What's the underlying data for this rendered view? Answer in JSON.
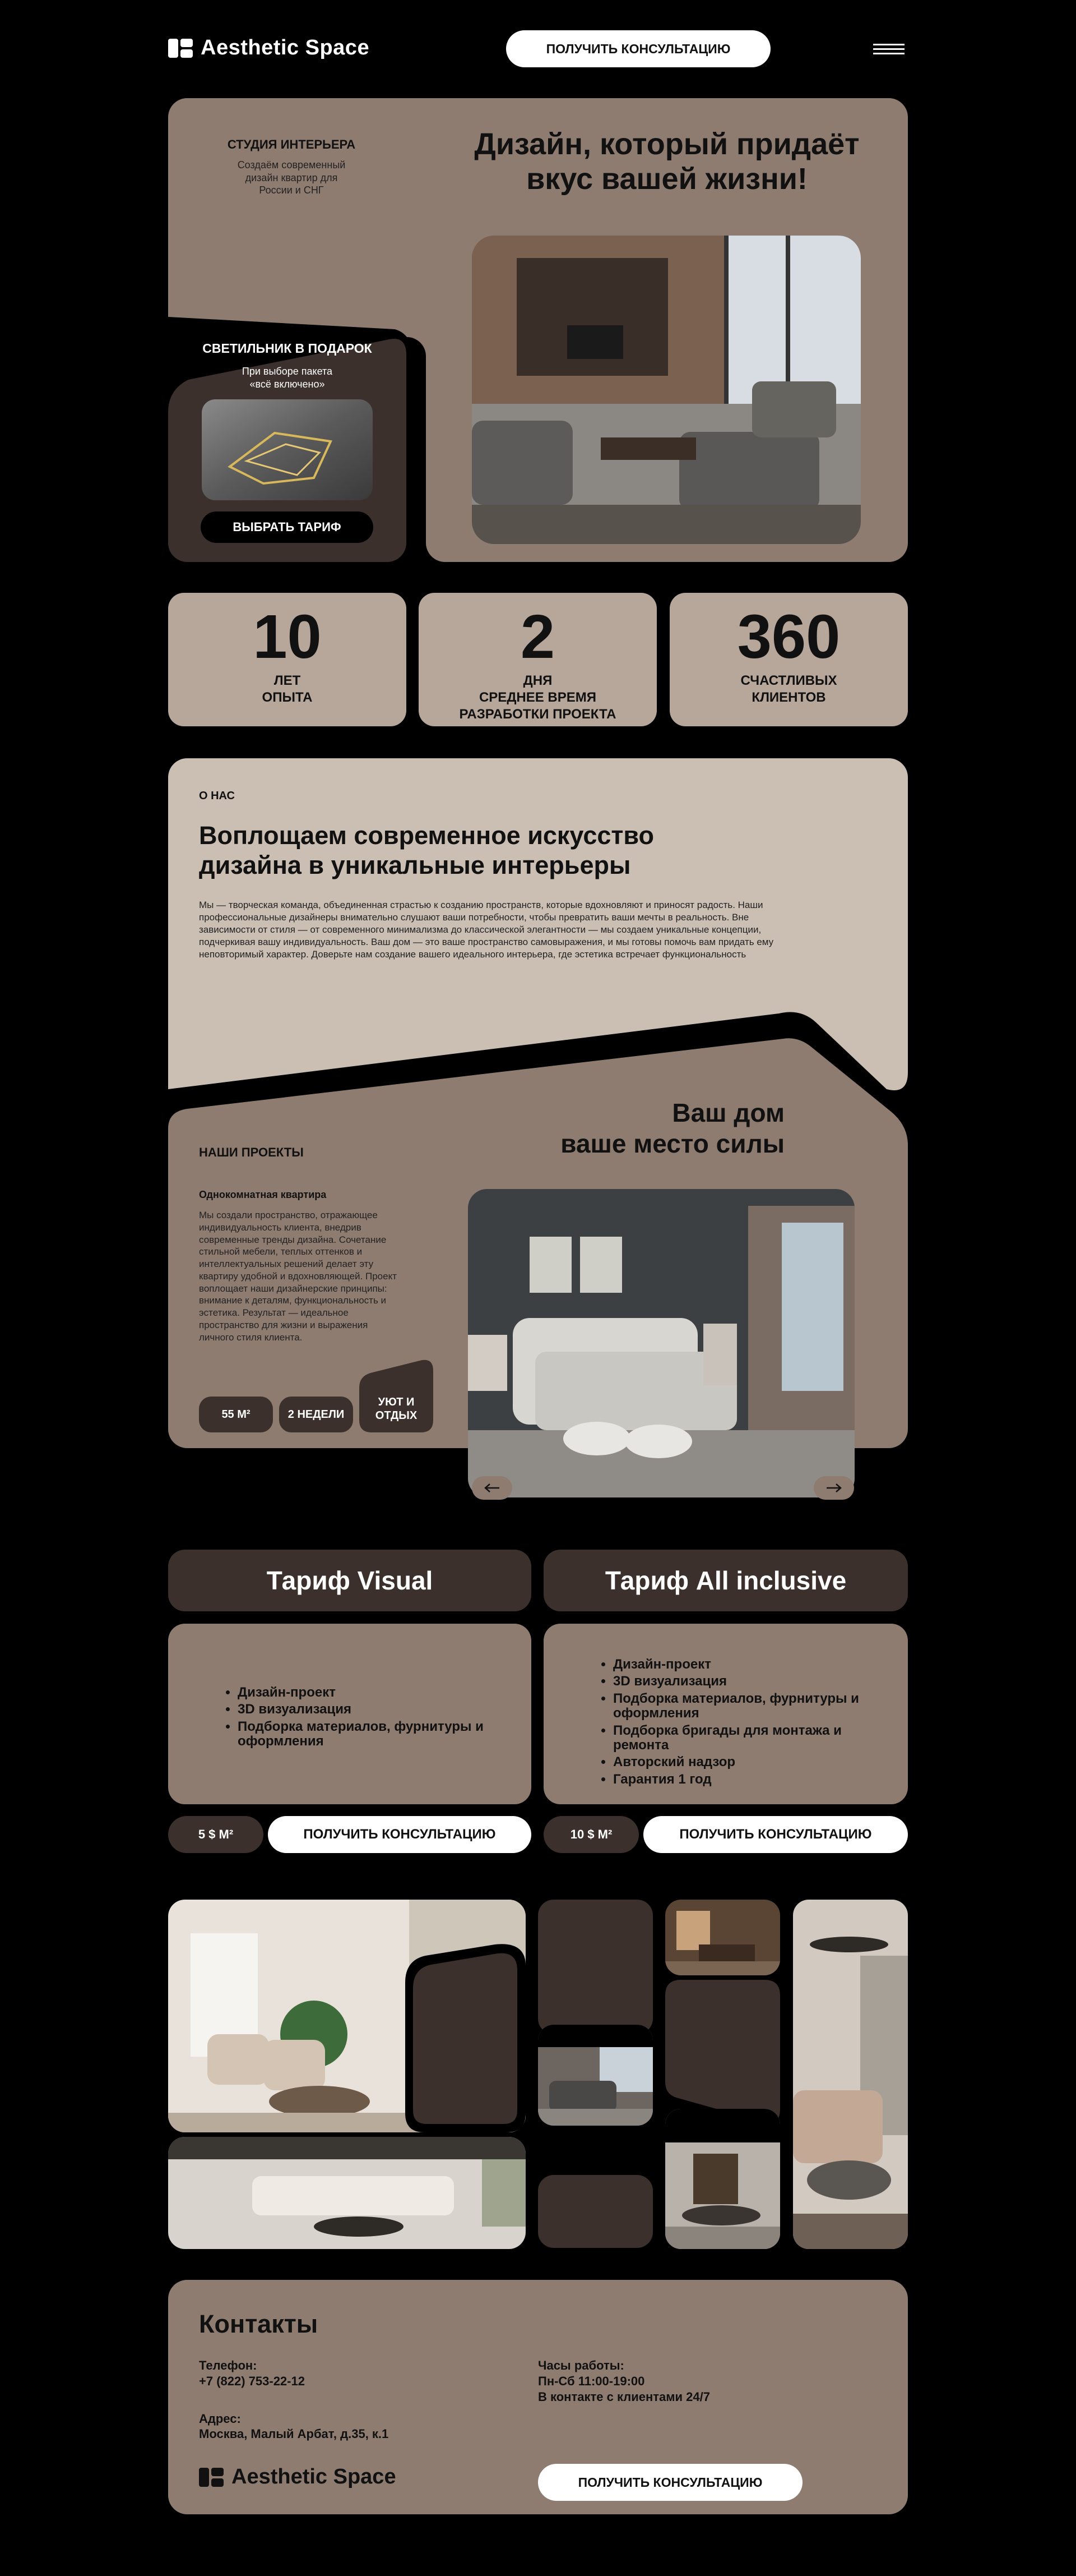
{
  "header": {
    "brand": "Aesthetic Space",
    "cta": "ПОЛУЧИТЬ КОНСУЛЬТАЦИЮ",
    "menu_icon": "hamburger-icon"
  },
  "hero": {
    "studio_title": "СТУДИЯ ИНТЕРЬЕРА",
    "studio_sub": "Создаём современный\nдизайн квартир для\nРоссии и СНГ",
    "headline": "Дизайн, который придаёт\nвкус вашей жизни!",
    "promo_title": "СВЕТИЛЬНИК В ПОДАРОК",
    "promo_sub": "При выборе пакета\n«всё включено»",
    "promo_button": "ВЫБРАТЬ ТАРИФ"
  },
  "stats": [
    {
      "value": "10",
      "label": "ЛЕТ\nОПЫТА"
    },
    {
      "value": "2",
      "label": "ДНЯ\nСРЕДНЕЕ ВРЕМЯ\nРАЗРАБОТКИ ПРОЕКТА"
    },
    {
      "value": "360",
      "label": "СЧАСТЛИВЫХ\nКЛИЕНТОВ"
    }
  ],
  "about": {
    "label": "О НАС",
    "title": "Воплощаем современное искусство\nдизайна в уникальные интерьеры",
    "text": "Мы — творческая команда, объединенная страстью к созданию пространств, которые вдохновляют и приносят радость. Наши профессиональные дизайнеры внимательно слушают ваши потребности, чтобы превратить ваши мечты в реальность. Вне зависимости от стиля — от современного минимализма до классической элегантности — мы создаем уникальные концепции, подчеркивая вашу индивидуальность. Ваш дом — это ваше пространство самовыражения, и мы готовы помочь вам придать ему неповторимый характер. Доверьте нам создание вашего идеального интерьера, где эстетика встречает функциональность"
  },
  "projects": {
    "label": "НАШИ ПРОЕКТЫ",
    "headline": "Ваш дом\nваше место силы",
    "project_title": "Однокомнатная квартира",
    "project_text": "Мы создали пространство, отражающее индивидуальность клиента, внедрив современные тренды дизайна. Сочетание стильной мебели, теплых оттенков и интеллектуальных решений делает эту квартиру удобной и вдохновляющей. Проект воплощает наши дизайнерские принципы: внимание к деталям, функциональность и эстетика. Результат — идеальное пространство для жизни и выражения личного стиля клиента.",
    "tags": [
      "55 М²",
      "2 НЕДЕЛИ",
      "УЮТ И\nОТДЫХ"
    ],
    "prev_icon": "arrow-left-icon",
    "next_icon": "arrow-right-icon"
  },
  "tariffs": [
    {
      "name": "Тариф Visual",
      "features": [
        "Дизайн-проект",
        "3D визуализация",
        "Подборка материалов, фурнитуры и оформления"
      ],
      "price": "5 $ М²",
      "cta": "ПОЛУЧИТЬ КОНСУЛЬТАЦИЮ"
    },
    {
      "name": "Тариф All inclusive",
      "features": [
        "Дизайн-проект",
        "3D визуализация",
        "Подборка материалов, фурнитуры и оформления",
        "Подборка бригады для монтажа и ремонта",
        "Авторский надзор",
        "Гарантия 1 год"
      ],
      "price": "10 $ М²",
      "cta": "ПОЛУЧИТЬ КОНСУЛЬТАЦИЮ"
    }
  ],
  "contacts": {
    "title": "Контакты",
    "phone_label": "Телефон:",
    "phone": "+7 (822) 753-22-12",
    "address_label": "Адрес:",
    "address": "Москва, Малый Арбат, д.35, к.1",
    "hours_label": "Часы работы:",
    "hours": "Пн-Сб 11:00-19:00",
    "hours_note": "В контакте с клиентами 24/7",
    "brand": "Aesthetic Space",
    "cta": "ПОЛУЧИТЬ КОНСУЛЬТАЦИЮ"
  },
  "colors": {
    "background": "#000000",
    "taupe": "#8f7c71",
    "dark": "#3b302b",
    "light": "#cbbfb4",
    "white": "#ffffff"
  }
}
